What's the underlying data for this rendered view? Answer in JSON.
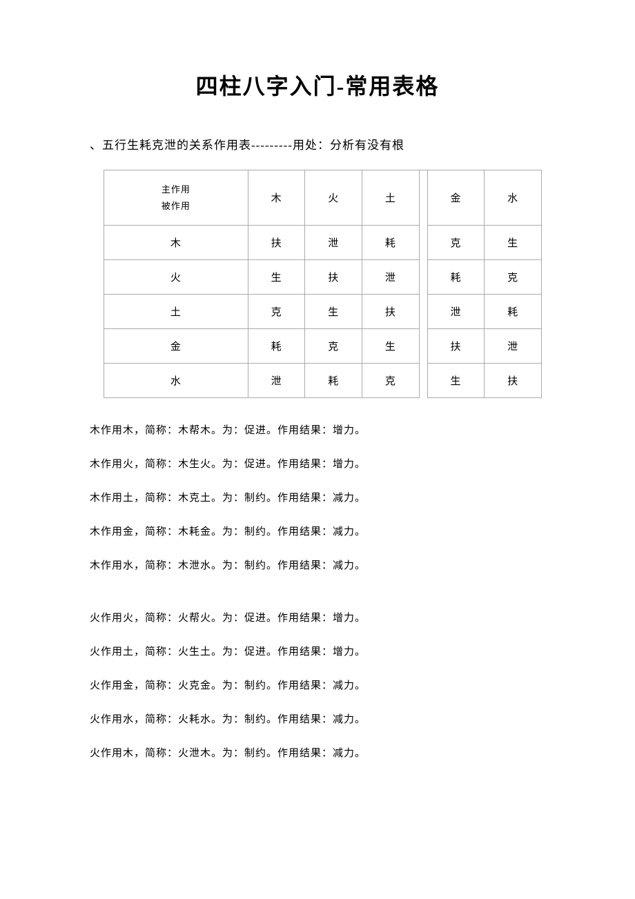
{
  "title": "四柱八字入门-常用表格",
  "subtitle": "、五行生耗克泄的关系作用表---------用处：分析有没有根",
  "table": {
    "header_main_line1": "主作用",
    "header_main_line2": "被作用",
    "cols": [
      "木",
      "火",
      "土",
      "金",
      "水"
    ],
    "rows": [
      {
        "label": "木",
        "cells": [
          "扶",
          "泄",
          "耗",
          "克",
          "生"
        ]
      },
      {
        "label": "火",
        "cells": [
          "生",
          "扶",
          "泄",
          "耗",
          "克"
        ]
      },
      {
        "label": "土",
        "cells": [
          "克",
          "生",
          "扶",
          "泄",
          "耗"
        ]
      },
      {
        "label": "金",
        "cells": [
          "耗",
          "克",
          "生",
          "扶",
          "泄"
        ]
      },
      {
        "label": "水",
        "cells": [
          "泄",
          "耗",
          "克",
          "生",
          "扶"
        ]
      }
    ]
  },
  "paragraphs": {
    "block1": [
      "木作用木，简称：木帮木。为：促进。作用结果：增力。",
      "木作用火，简称：木生火。为：促进。作用结果：增力。",
      "木作用土，简称：木克土。为：制约。作用结果：减力。",
      "木作用金，简称：木耗金。为：制约。作用结果：减力。",
      "木作用水，简称：木泄水。为：制约。作用结果：减力。"
    ],
    "block2": [
      "火作用火，简称：火帮火。为：促进。作用结果：增力。",
      "火作用土，简称：火生土。为：促进。作用结果：增力。",
      "火作用金，简称：火克金。为：制约。作用结果：减力。",
      "火作用水，简称：火耗水。为：制约。作用结果：减力。",
      "火作用木，简称：火泄木。为：制约。作用结果：减力。"
    ]
  }
}
